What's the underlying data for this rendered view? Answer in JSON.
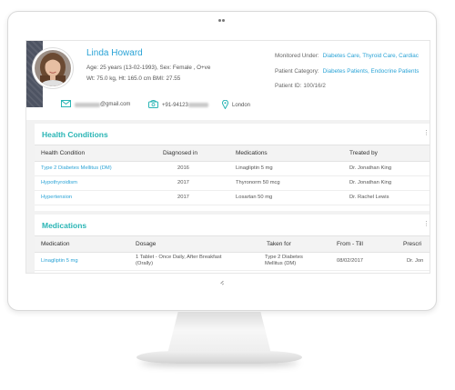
{
  "profile": {
    "name": "Linda Howard",
    "age_sex": "Age: 25 years (13-02-1993), Sex: Female , O+ve",
    "vitals": "Wt: 75.0 kg, Ht: 165.0 cm BMI: 27.55",
    "monitored_label": "Monitored Under:",
    "monitored_value": "Diabetes Care, Thyroid Care, Cardiac",
    "category_label": "Patient Category:",
    "category_value": "Diabetes Patients, Endocrine Patients",
    "patient_id_label": "Patient ID:",
    "patient_id_value": "100/16/2",
    "email_suffix": "@gmail.com",
    "phone_prefix": "+91-94123",
    "location": "London"
  },
  "health_conditions": {
    "title": "Health Conditions",
    "columns": [
      "Health Condition",
      "Diagnosed in",
      "Medications",
      "Treated by"
    ],
    "rows": [
      {
        "condition": "Type 2 Diabetes Mellitus (DM)",
        "year": "2016",
        "medication": "Linagliptin 5 mg",
        "doctor": "Dr. Jonathan King"
      },
      {
        "condition": "Hypothyroidism",
        "year": "2017",
        "medication": "Thyronorm  50 mcg",
        "doctor": "Dr. Jonathan King"
      },
      {
        "condition": "Hypertension",
        "year": "2017",
        "medication": "Losartan 50 mg",
        "doctor": "Dr. Rachel Lewis"
      }
    ]
  },
  "medications": {
    "title": "Medications",
    "columns": [
      "Medication",
      "Dosage",
      "Taken for",
      "From - Till",
      "Prescri"
    ],
    "rows": [
      {
        "medication": "Linagliptin 5 mg",
        "dosage_line1": "1 Tablet -  Once Daily, After Breakfast",
        "dosage_line2": "(Orally)",
        "taken_for_line1": "Type 2 Diabetes",
        "taken_for_line2": "Mellitus (DM)",
        "from": "08/02/2017",
        "prescriber": "Dr. Jon"
      }
    ]
  },
  "colors": {
    "accent_blue": "#2aa3d6",
    "section_title_teal": "#2ab5b5",
    "side_strip": "#4d5362"
  },
  "icons": [
    "email-icon",
    "phone-icon",
    "location-pin-icon",
    "more-icon"
  ]
}
